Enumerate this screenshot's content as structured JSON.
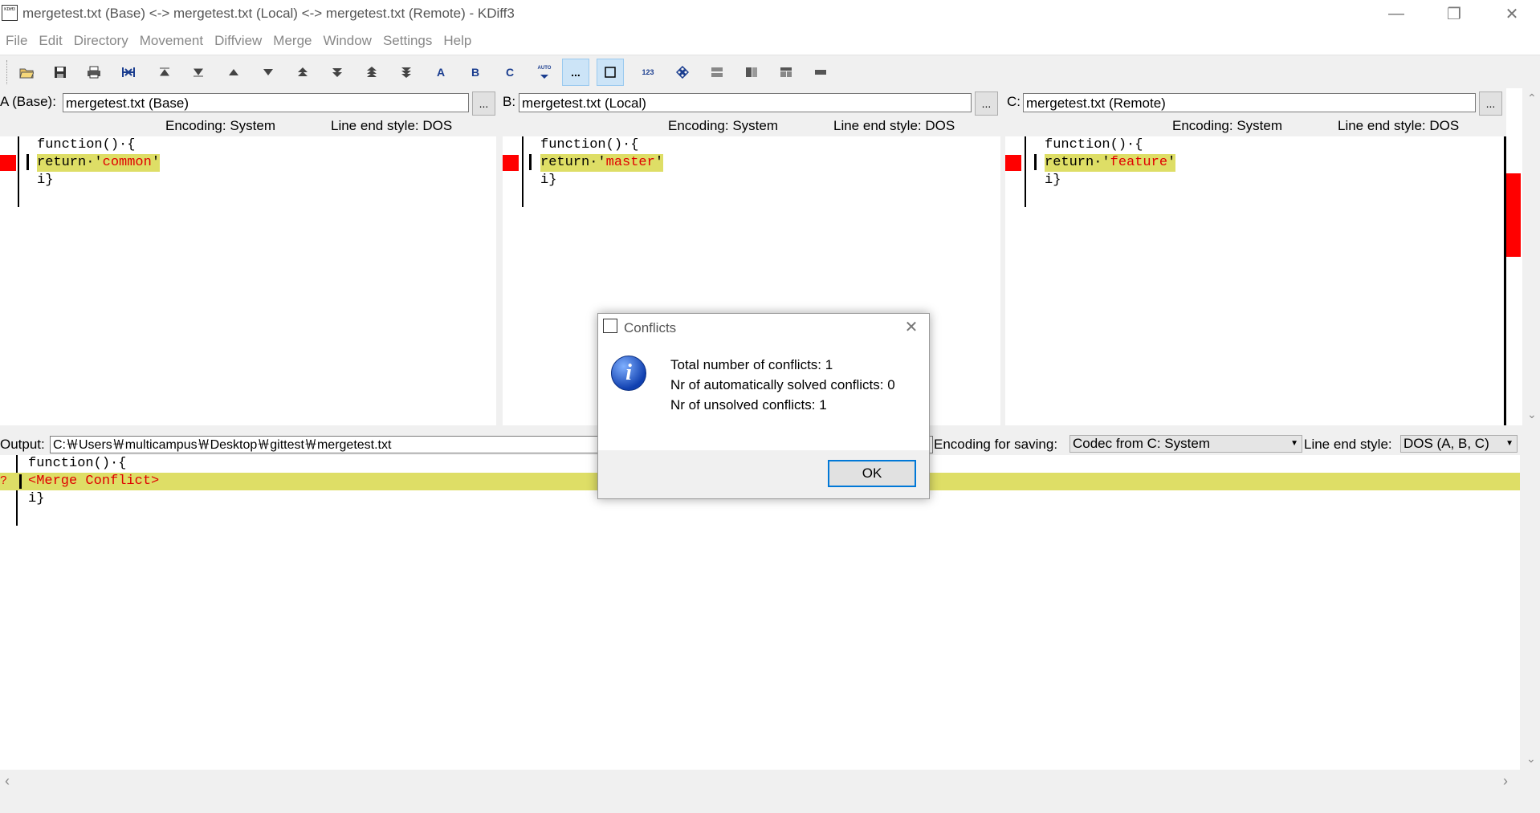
{
  "window": {
    "title": "mergetest.txt (Base) <-> mergetest.txt (Local) <-> mergetest.txt (Remote) - KDiff3",
    "icon_text": "KDiff3",
    "controls": [
      "minimize-icon",
      "restore-icon",
      "close-icon"
    ]
  },
  "menu": [
    "File",
    "Edit",
    "Directory",
    "Movement",
    "Diffview",
    "Merge",
    "Window",
    "Settings",
    "Help"
  ],
  "toolbar": {
    "buttons": [
      "open-icon",
      "save-icon",
      "print-icon",
      "merge-icon",
      "go-top-icon",
      "go-bottom-icon",
      "prev-delta-icon",
      "next-delta-icon",
      "prev-conflict-icon",
      "next-conflict-icon",
      "prev-unsolved-icon",
      "next-unsolved-icon",
      "choose-a-icon",
      "choose-b-icon",
      "choose-c-icon",
      "auto-solve-icon",
      "show-whitespace-icon",
      "show-whitespace-chars-icon",
      "line-numbers-icon",
      "toggle-overview-icon",
      "split-view-icon",
      "split-view-2-icon",
      "split-view-3-icon",
      "show-window-icon"
    ],
    "labels": {
      "choose_a": "A",
      "choose_b": "B",
      "choose_c": "C",
      "auto": "AUTO",
      "numbers": "123",
      "whitespace": "..."
    }
  },
  "panes": [
    {
      "label": "A (Base):",
      "file": "mergetest.txt (Base)",
      "browse": "...",
      "encoding": "Encoding: System",
      "line_end": "Line end style: DOS",
      "lines": {
        "l1": "function()·{",
        "l2_prefix": "return·'",
        "l2_word": "common",
        "l2_suffix": "'",
        "l3": "i}"
      }
    },
    {
      "label": "B:",
      "file": "mergetest.txt (Local)",
      "browse": "...",
      "encoding": "Encoding: System",
      "line_end": "Line end style: DOS",
      "lines": {
        "l1": "function()·{",
        "l2_prefix": "return·'",
        "l2_word": "master",
        "l2_suffix": "'",
        "l3": "i}"
      }
    },
    {
      "label": "C:",
      "file": "mergetest.txt (Remote)",
      "browse": "...",
      "encoding": "Encoding: System",
      "line_end": "Line end style: DOS",
      "lines": {
        "l1": "function()·{",
        "l2_prefix": "return·'",
        "l2_word": "feature",
        "l2_suffix": "'",
        "l3": "i}"
      }
    }
  ],
  "output": {
    "label": "Output:",
    "path": "C:￦Users￦multicampus￦Desktop￦gittest￦mergetest.txt",
    "encoding_label": "Encoding for saving:",
    "encoding_value": "Codec from C: System",
    "line_end_label": "Line end style:",
    "line_end_value": "DOS (A, B, C)",
    "lines": {
      "l1": "function()·{",
      "l2": "<Merge Conflict>",
      "l3": "i}"
    },
    "conflict_marker": "?"
  },
  "dialog": {
    "title": "Conflicts",
    "line1": "Total number of conflicts: 1",
    "line2": "Nr of automatically solved conflicts: 0",
    "line3": "Nr of unsolved conflicts: 1",
    "ok": "OK",
    "icon": "info-icon"
  },
  "colors": {
    "conflict": "#ff0000",
    "highlight": "#dede66",
    "accent": "#0078d7"
  }
}
